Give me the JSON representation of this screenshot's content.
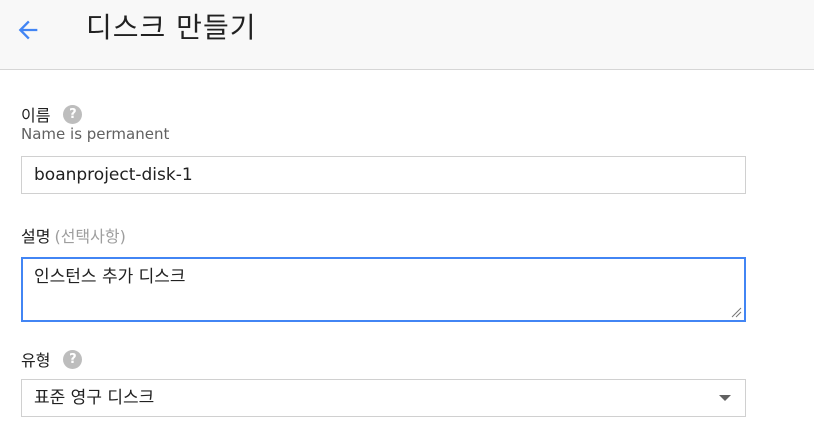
{
  "header": {
    "back_icon": "arrow-left-icon",
    "title": "디스크 만들기",
    "accent_color": "#4285f4"
  },
  "form": {
    "name": {
      "label": "이름",
      "help_icon": "help-circle-icon",
      "hint": "Name is permanent",
      "value": "boanproject-disk-1"
    },
    "description": {
      "label": "설명",
      "optional_label": "(선택사항)",
      "value": "인스턴스 추가 디스크"
    },
    "type": {
      "label": "유형",
      "help_icon": "help-circle-icon",
      "selected": "표준 영구 디스크",
      "dropdown_icon": "caret-down-icon"
    }
  }
}
